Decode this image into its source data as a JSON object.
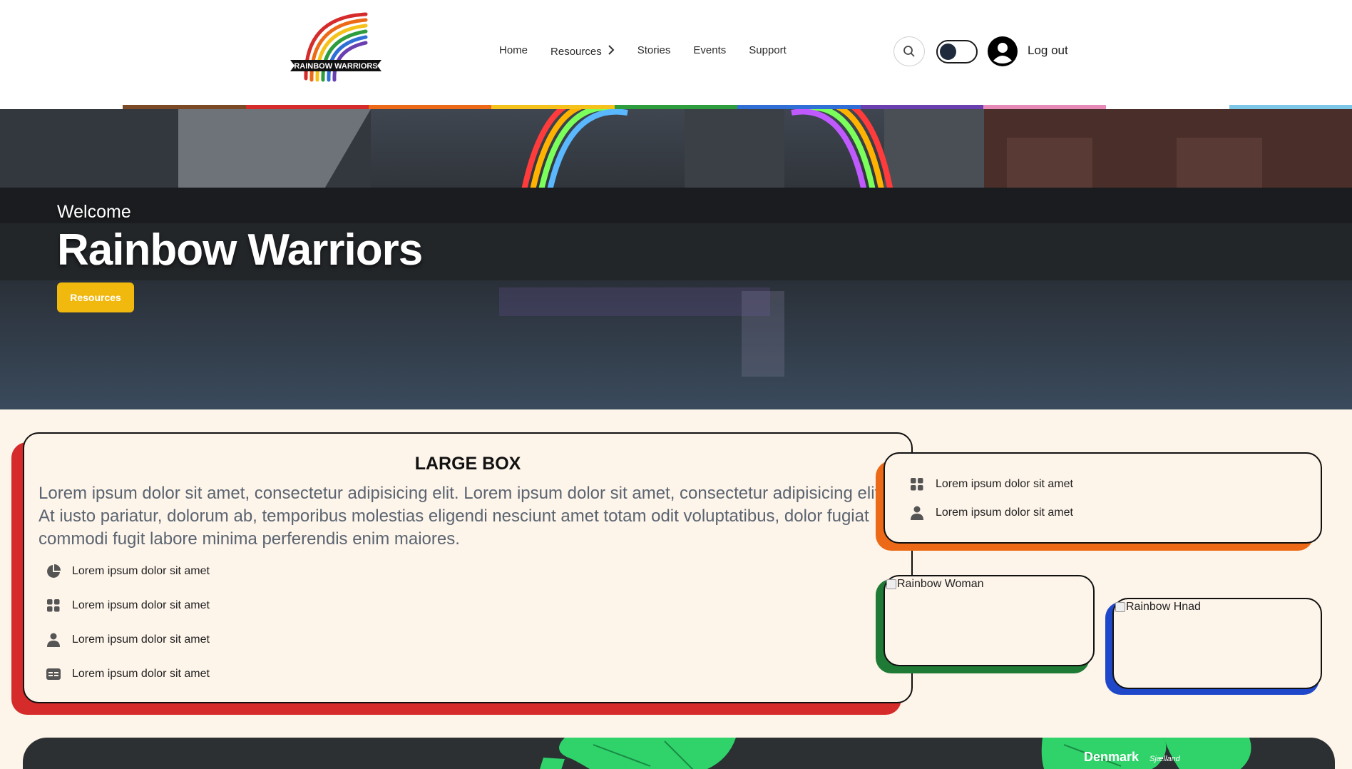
{
  "header": {
    "logo_text": "RAINBOW WARRIORS",
    "nav": [
      {
        "label": "Home"
      },
      {
        "label": "Resources",
        "has_submenu": true
      },
      {
        "label": "Stories"
      },
      {
        "label": "Events"
      },
      {
        "label": "Support"
      }
    ],
    "search_icon": "search-icon",
    "theme_toggle": {
      "state": "dark",
      "icon": "toggle-icon"
    },
    "account_icon": "user-circle-icon",
    "logout_label": "Log out"
  },
  "pride_stripe_colors": [
    "#ffffff",
    "#7a4a26",
    "#d62b2b",
    "#ec6a17",
    "#f4c21b",
    "#2e9d3e",
    "#2f6fd6",
    "#6a3fb0",
    "#e88ab8",
    "#ffffff",
    "#7cc7e8"
  ],
  "hero": {
    "welcome": "Welcome",
    "title": "Rainbow Warriors",
    "button_label": "Resources"
  },
  "large_box": {
    "title": "LARGE BOX",
    "text": "Lorem ipsum dolor sit amet, consectetur adipisicing elit. Lorem ipsum dolor sit amet, consectetur adipisicing elit. At iusto pariatur, dolorum ab, temporibus molestias eligendi nesciunt amet totam odit voluptatibus, dolor fugiat commodi fugit labore minima perferendis enim maiores.",
    "items": [
      {
        "icon": "pie-chart-icon",
        "label": "Lorem ipsum dolor sit amet"
      },
      {
        "icon": "grid-icon",
        "label": "Lorem ipsum dolor sit amet"
      },
      {
        "icon": "person-icon",
        "label": "Lorem ipsum dolor sit amet"
      },
      {
        "icon": "card-icon",
        "label": "Lorem ipsum dolor sit amet"
      }
    ],
    "accent": "#d62b2b"
  },
  "small_box": {
    "items": [
      {
        "icon": "grid-icon",
        "label": "Lorem ipsum dolor sit amet"
      },
      {
        "icon": "person-icon",
        "label": "Lorem ipsum dolor sit amet"
      }
    ],
    "accent": "#ec6a17"
  },
  "image_boxes": [
    {
      "alt": "Rainbow Woman",
      "accent": "#1f7a35"
    },
    {
      "alt": "Rainbow Hnad",
      "accent": "#1f47c9"
    }
  ],
  "map": {
    "label": "Denmark",
    "sublabel": "Sjælland"
  }
}
